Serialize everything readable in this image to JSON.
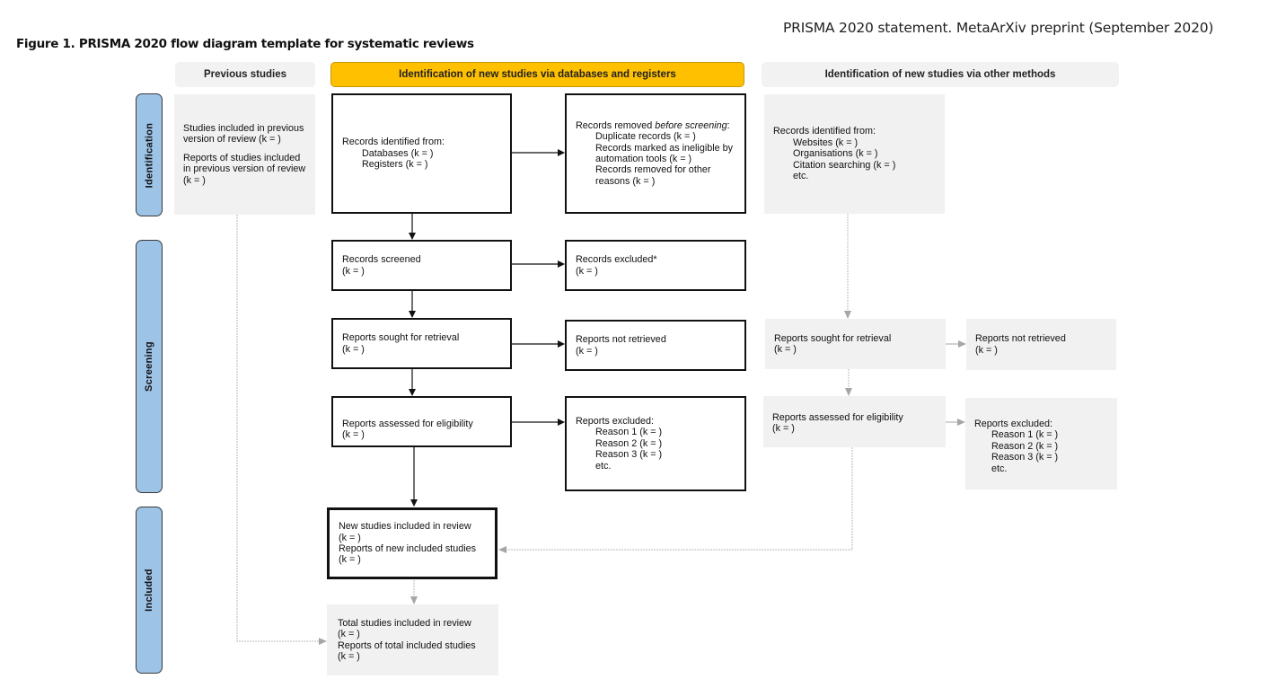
{
  "header_note": "PRISMA 2020 statement. MetaArXiv preprint (September 2020)",
  "figure_title": "Figure 1. PRISMA 2020 flow diagram template for systematic reviews",
  "colors": {
    "phase_fill": "#9dc3e6",
    "databases_header_fill": "#ffc000",
    "gray_fill": "#f1f1f1",
    "black_stroke": "#111111",
    "gray_stroke": "#a6a6a6"
  },
  "column_headers": {
    "previous": "Previous studies",
    "databases": "Identification of new studies via databases and registers",
    "other": "Identification of new studies via other methods"
  },
  "phases": {
    "identification": "Identification",
    "screening": "Screening",
    "included": "Included"
  },
  "previous": {
    "studies_included": "Studies included in previous version of review (k = )",
    "reports_included": "Reports of studies included in previous version of review (k = )"
  },
  "databases": {
    "identified": {
      "title": "Records identified from:",
      "items": [
        "Databases (k = )",
        "Registers (k = )"
      ]
    },
    "removed": {
      "title_pre": "Records removed ",
      "title_em": "before screening",
      "title_post": ":",
      "items": [
        "Duplicate records (k = )",
        "Records marked as ineligible by automation tools (k = )",
        "Records removed for other reasons (k = )"
      ]
    },
    "screened": {
      "title": "Records screened",
      "count": "(k = )"
    },
    "excluded": {
      "title": "Records excluded*",
      "count": "(k = )"
    },
    "sought": {
      "title": "Reports sought for retrieval",
      "count": "(k = )"
    },
    "not_retrieved": {
      "title": "Reports not retrieved",
      "count": "(k = )"
    },
    "assessed": {
      "title": "Reports assessed for eligibility",
      "count": "(k = )"
    },
    "reports_excluded": {
      "title": "Reports excluded:",
      "items": [
        "Reason 1 (k = )",
        "Reason 2 (k = )",
        "Reason 3 (k = )",
        "etc."
      ]
    },
    "new_included": {
      "line1": "New studies included in review",
      "line2": "(k = )",
      "line3": "Reports of new included studies",
      "line4": "(k = )"
    },
    "total_included": {
      "line1": "Total studies included in review",
      "line2": "(k = )",
      "line3": "Reports of total included studies",
      "line4": "(k = )"
    }
  },
  "other": {
    "identified": {
      "title": "Records identified from:",
      "items": [
        "Websites (k = )",
        "Organisations (k = )",
        "Citation searching (k = )",
        "etc."
      ]
    },
    "sought": {
      "title": "Reports sought for retrieval",
      "count": "(k = )"
    },
    "not_retrieved": {
      "title": "Reports not retrieved",
      "count": "(k = )"
    },
    "assessed": {
      "title": "Reports assessed for eligibility",
      "count": "(k = )"
    },
    "reports_excluded": {
      "title": "Reports excluded:",
      "items": [
        "Reason 1 (k = )",
        "Reason 2 (k = )",
        "Reason 3 (k = )",
        "etc."
      ]
    }
  }
}
